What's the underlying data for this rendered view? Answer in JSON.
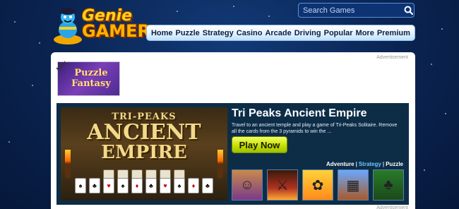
{
  "header": {
    "logo": {
      "line1": "Genie",
      "line2": "GAMER"
    },
    "search": {
      "placeholder": "Search Games"
    }
  },
  "nav": {
    "items": [
      "Home",
      "Puzzle",
      "Strategy",
      "Casino",
      "Arcade",
      "Driving",
      "Popular",
      "More",
      "Premium"
    ]
  },
  "panel": {
    "ad_label": "Advertisement",
    "promo": {
      "badge": "New",
      "title_line1": "Puzzle",
      "title_line2": "Fantasy"
    },
    "feature": {
      "image_title": {
        "line1": "TRI-PEAKS",
        "line2": "ANCIENT",
        "line3": "EMPIRE"
      },
      "title": "Tri Peaks Ancient Empire",
      "description": "Travel to an ancient temple and play a game of Tri-Peaks Solitaire. Remove all the cards from the 3 pyramids to win the ...",
      "play_label": "Play Now",
      "categories": [
        "Adventure",
        "Strategy",
        "Puzzle"
      ],
      "active_category": "Strategy"
    }
  },
  "colors": {
    "background": "#0a2350",
    "nav_text": "#0b1e3e",
    "play_button": "#c6e000",
    "feature_bg": "#0d2d47",
    "active_category": "#6fc6ff"
  }
}
